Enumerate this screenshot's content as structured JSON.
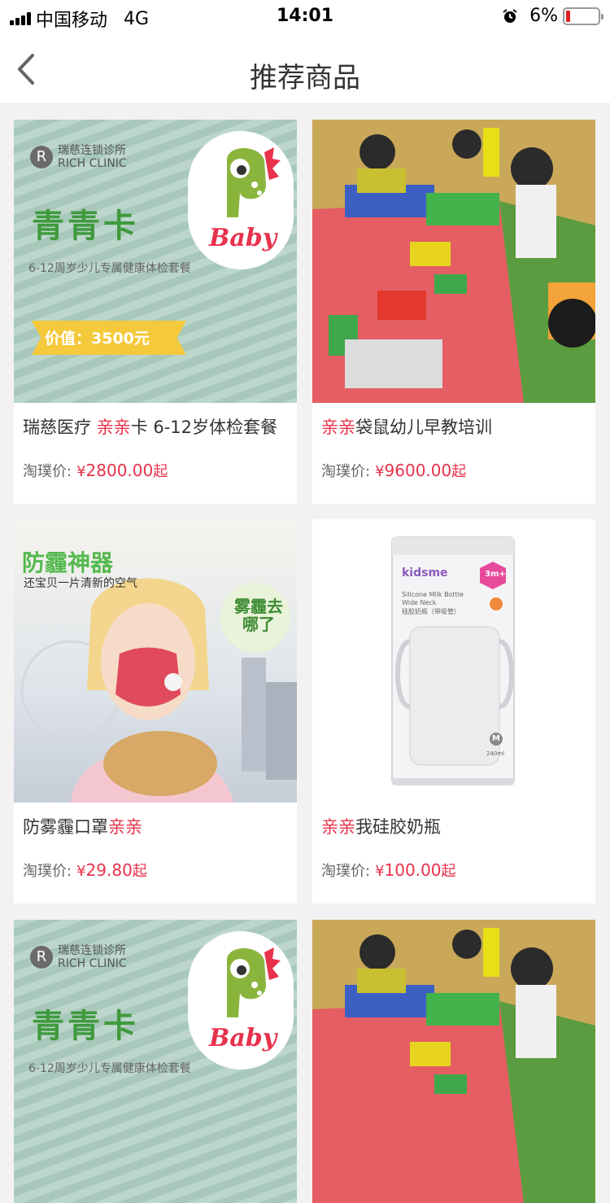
{
  "status_bar": {
    "carrier": "中国移动",
    "network": "4G",
    "time": "14:01",
    "battery": "6%"
  },
  "nav": {
    "title": "推荐商品",
    "back_icon": "chevron-left-icon"
  },
  "colors": {
    "accent": "#e8324c",
    "background": "#f2f2f2"
  },
  "products": [
    {
      "title_prefix": "瑞慈医疗 ",
      "title_highlight": "亲亲",
      "title_suffix": "卡 6-12岁体检套餐",
      "price_label": "淘璞价:",
      "currency": "¥",
      "price": "2800.00",
      "price_suffix": "起",
      "image": {
        "logo_text_cn": "瑞慈连锁诊所",
        "logo_text_en": "RICH CLINIC",
        "headline": "青青卡",
        "subline": "6-12周岁少儿专属健康体检套餐",
        "ribbon": "价值：3500元",
        "badge": "Baby"
      }
    },
    {
      "title_prefix": "",
      "title_highlight": "亲亲",
      "title_suffix": "袋鼠幼儿早教培训",
      "price_label": "淘璞价:",
      "currency": "¥",
      "price": "9600.00",
      "price_suffix": "起",
      "image": {}
    },
    {
      "title_prefix": "防雾霾口罩",
      "title_highlight": "亲亲",
      "title_suffix": "",
      "price_label": "淘璞价:",
      "currency": "¥",
      "price": "29.80",
      "price_suffix": "起",
      "image": {
        "headline": "防霾神器",
        "subline": "还宝贝一片清新的空气",
        "badge": "雾霾去哪了"
      }
    },
    {
      "title_prefix": "",
      "title_highlight": "亲亲",
      "title_suffix": "我硅胶奶瓶",
      "price_label": "淘璞价:",
      "currency": "¥",
      "price": "100.00",
      "price_suffix": "起",
      "image": {
        "brand": "kidsme",
        "line1": "Silicone Milk Bottle",
        "line2": "Wide Neck",
        "line3": "硅胶奶瓶（带吸管）",
        "age": "3m+",
        "size": "M",
        "volume": "240ml"
      }
    },
    {
      "image": {
        "logo_text_cn": "瑞慈连锁诊所",
        "logo_text_en": "RICH CLINIC",
        "headline": "青青卡",
        "subline": "6-12周岁少儿专属健康体检套餐",
        "badge": "Baby"
      }
    },
    {
      "image": {}
    }
  ]
}
